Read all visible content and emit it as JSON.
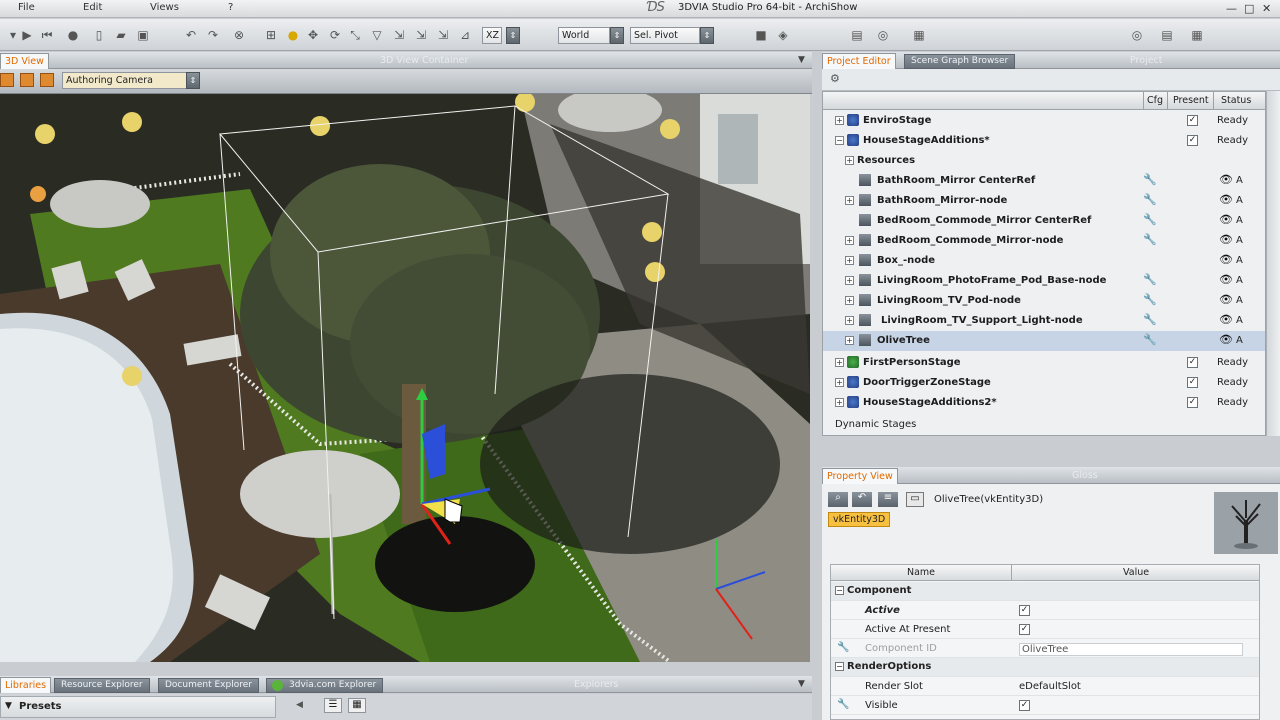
{
  "menu": [
    "File",
    "Edit",
    "Views",
    "?"
  ],
  "window_title": "3DVIA Studio Pro 64-bit - ArchiShow",
  "toolbar": {
    "axis_value": "XZ",
    "space_value": "World",
    "pivot_value": "Sel. Pivot"
  },
  "view3d": {
    "tab_label": "3D View",
    "container_label": "3D View Container",
    "camera_value": "Authoring Camera"
  },
  "project_panel": {
    "tabs": [
      "Project Editor",
      "Scene Graph Browser"
    ],
    "ghost_label": "Project",
    "columns": {
      "cfg": "Cfg",
      "present": "Present",
      "status": "Status"
    },
    "rows": [
      {
        "label": "EnviroStage",
        "status": "Ready",
        "checked": true
      },
      {
        "label": "HouseStageAdditions*",
        "status": "Ready",
        "checked": true
      },
      {
        "label": "Resources"
      },
      {
        "label": "BathRoom_Mirror CenterRef",
        "letter": "A"
      },
      {
        "label": "BathRoom_Mirror-node",
        "letter": "A"
      },
      {
        "label": "BedRoom_Commode_Mirror CenterRef",
        "letter": "A"
      },
      {
        "label": "BedRoom_Commode_Mirror-node",
        "letter": "A"
      },
      {
        "label": "Box_-node",
        "letter": "A"
      },
      {
        "label": "LivingRoom_PhotoFrame_Pod_Base-node",
        "letter": "A"
      },
      {
        "label": "LivingRoom_TV_Pod-node",
        "letter": "A"
      },
      {
        "label": "LivingRoom_TV_Support_Light-node",
        "letter": "A"
      },
      {
        "label": "OliveTree",
        "letter": "A"
      },
      {
        "label": "FirstPersonStage",
        "status": "Ready",
        "checked": true
      },
      {
        "label": "DoorTriggerZoneStage",
        "status": "Ready",
        "checked": true
      },
      {
        "label": "HouseStageAdditions2*",
        "status": "Ready",
        "checked": true
      }
    ],
    "footer": "Dynamic Stages"
  },
  "property_view": {
    "tab_label": "Property View",
    "ghost_label": "Gloss",
    "object_label": "OliveTree(vkEntity3D)",
    "type_badge": "vkEntity3D",
    "columns": {
      "name": "Name",
      "value": "Value"
    },
    "groups": {
      "component": "Component",
      "render": "RenderOptions"
    },
    "props": {
      "active": "Active",
      "active_at_present": "Active At Present",
      "component_id": "Component ID",
      "component_id_value": "OliveTree",
      "render_slot": "Render Slot",
      "render_slot_value": "eDefaultSlot",
      "visible": "Visible"
    }
  },
  "explorers": {
    "tabs": [
      "Libraries",
      "Resource Explorer",
      "Document Explorer",
      "3dvia.com Explorer"
    ],
    "ghost_label": "Explorers",
    "presets_label": "Presets"
  },
  "colors": {
    "accent_orange": "#e06a00",
    "selection": "#c7d4e5",
    "viewport_dark": "#24281f"
  }
}
